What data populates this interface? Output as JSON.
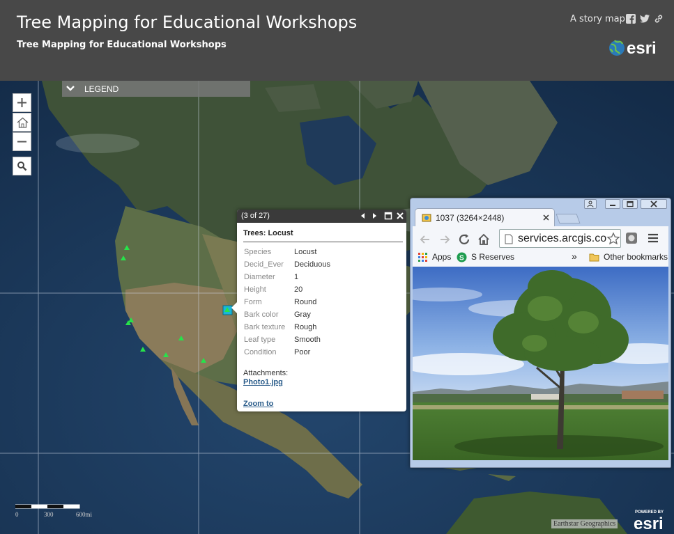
{
  "header": {
    "title": "Tree Mapping for Educational Workshops",
    "subtitle": "Tree Mapping for Educational Workshops",
    "story_map_link": "A story map",
    "share_icons": [
      "facebook-icon",
      "twitter-icon",
      "link-icon"
    ],
    "brand": "esri",
    "background_color": "#484848"
  },
  "map": {
    "legend_label": "LEGEND",
    "controls": [
      "zoom-in",
      "home",
      "zoom-out",
      "search"
    ],
    "tree_marker_color": "#27e34a",
    "selected_marker_color": "#19b6d8"
  },
  "popup": {
    "counter": "(3 of 27)",
    "title": "Trees: Locust",
    "attributes": [
      {
        "key": "Species",
        "value": "Locust"
      },
      {
        "key": "Decid_Ever",
        "value": "Deciduous"
      },
      {
        "key": "Diameter",
        "value": "1"
      },
      {
        "key": "Height",
        "value": "20"
      },
      {
        "key": "Form",
        "value": "Round"
      },
      {
        "key": "Bark color",
        "value": "Gray"
      },
      {
        "key": "Bark texture",
        "value": "Rough"
      },
      {
        "key": "Leaf type",
        "value": "Smooth"
      },
      {
        "key": "Condition",
        "value": "Poor"
      }
    ],
    "attachments_label": "Attachments:",
    "attachment_name": "Photo1.jpg",
    "zoom_link": "Zoom to"
  },
  "browser": {
    "tab_title": "1037 (3264×2448)",
    "url": "services.arcgis.com",
    "bookmarks": {
      "apps": "Apps",
      "s_reserves": "S Reserves",
      "more": "»",
      "other": "Other bookmarks"
    }
  },
  "footer": {
    "scale_labels": [
      "0",
      "300",
      "600mi"
    ],
    "attribution": "Earthstar Geographics",
    "powered_by": "POWERED BY",
    "powered_brand": "esri"
  }
}
